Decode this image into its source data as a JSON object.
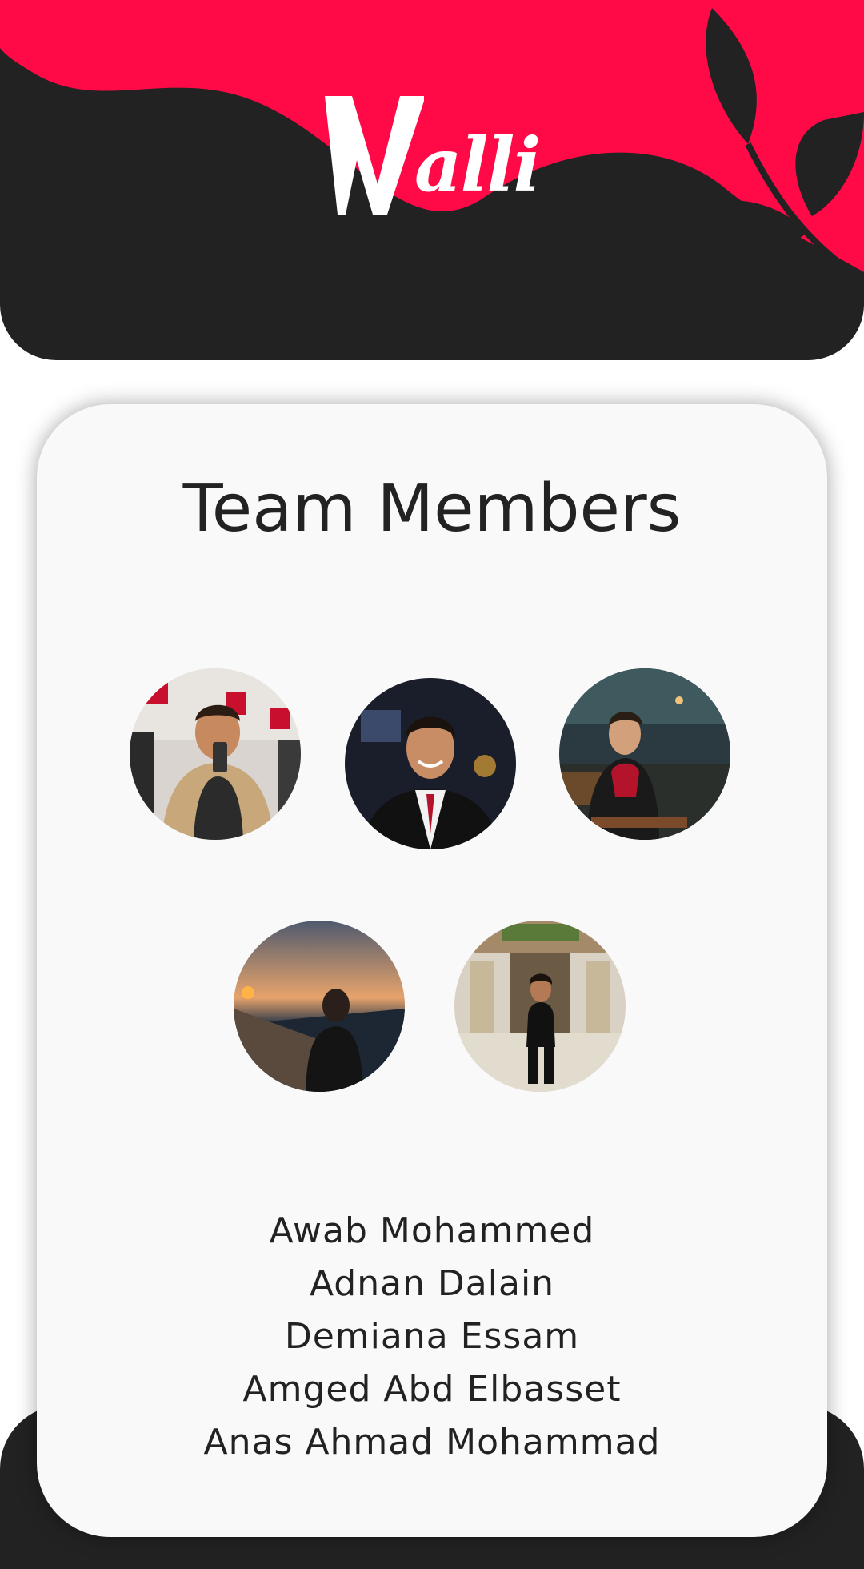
{
  "app": {
    "logo_initial": "W",
    "logo_rest": "alli"
  },
  "colors": {
    "accent": "#ff0a47",
    "dark": "#222223",
    "card": "#f9f9f9",
    "text": "#222222"
  },
  "page": {
    "title": "Team Members"
  },
  "team": {
    "avatars": [
      {
        "icon": "avatar-photo-1"
      },
      {
        "icon": "avatar-photo-2"
      },
      {
        "icon": "avatar-photo-3"
      },
      {
        "icon": "avatar-photo-4"
      },
      {
        "icon": "avatar-photo-5"
      }
    ],
    "members": [
      "Awab Mohammed",
      "Adnan Dalain",
      "Demiana Essam",
      "Amged Abd Elbasset",
      "Anas Ahmad Mohammad"
    ]
  }
}
